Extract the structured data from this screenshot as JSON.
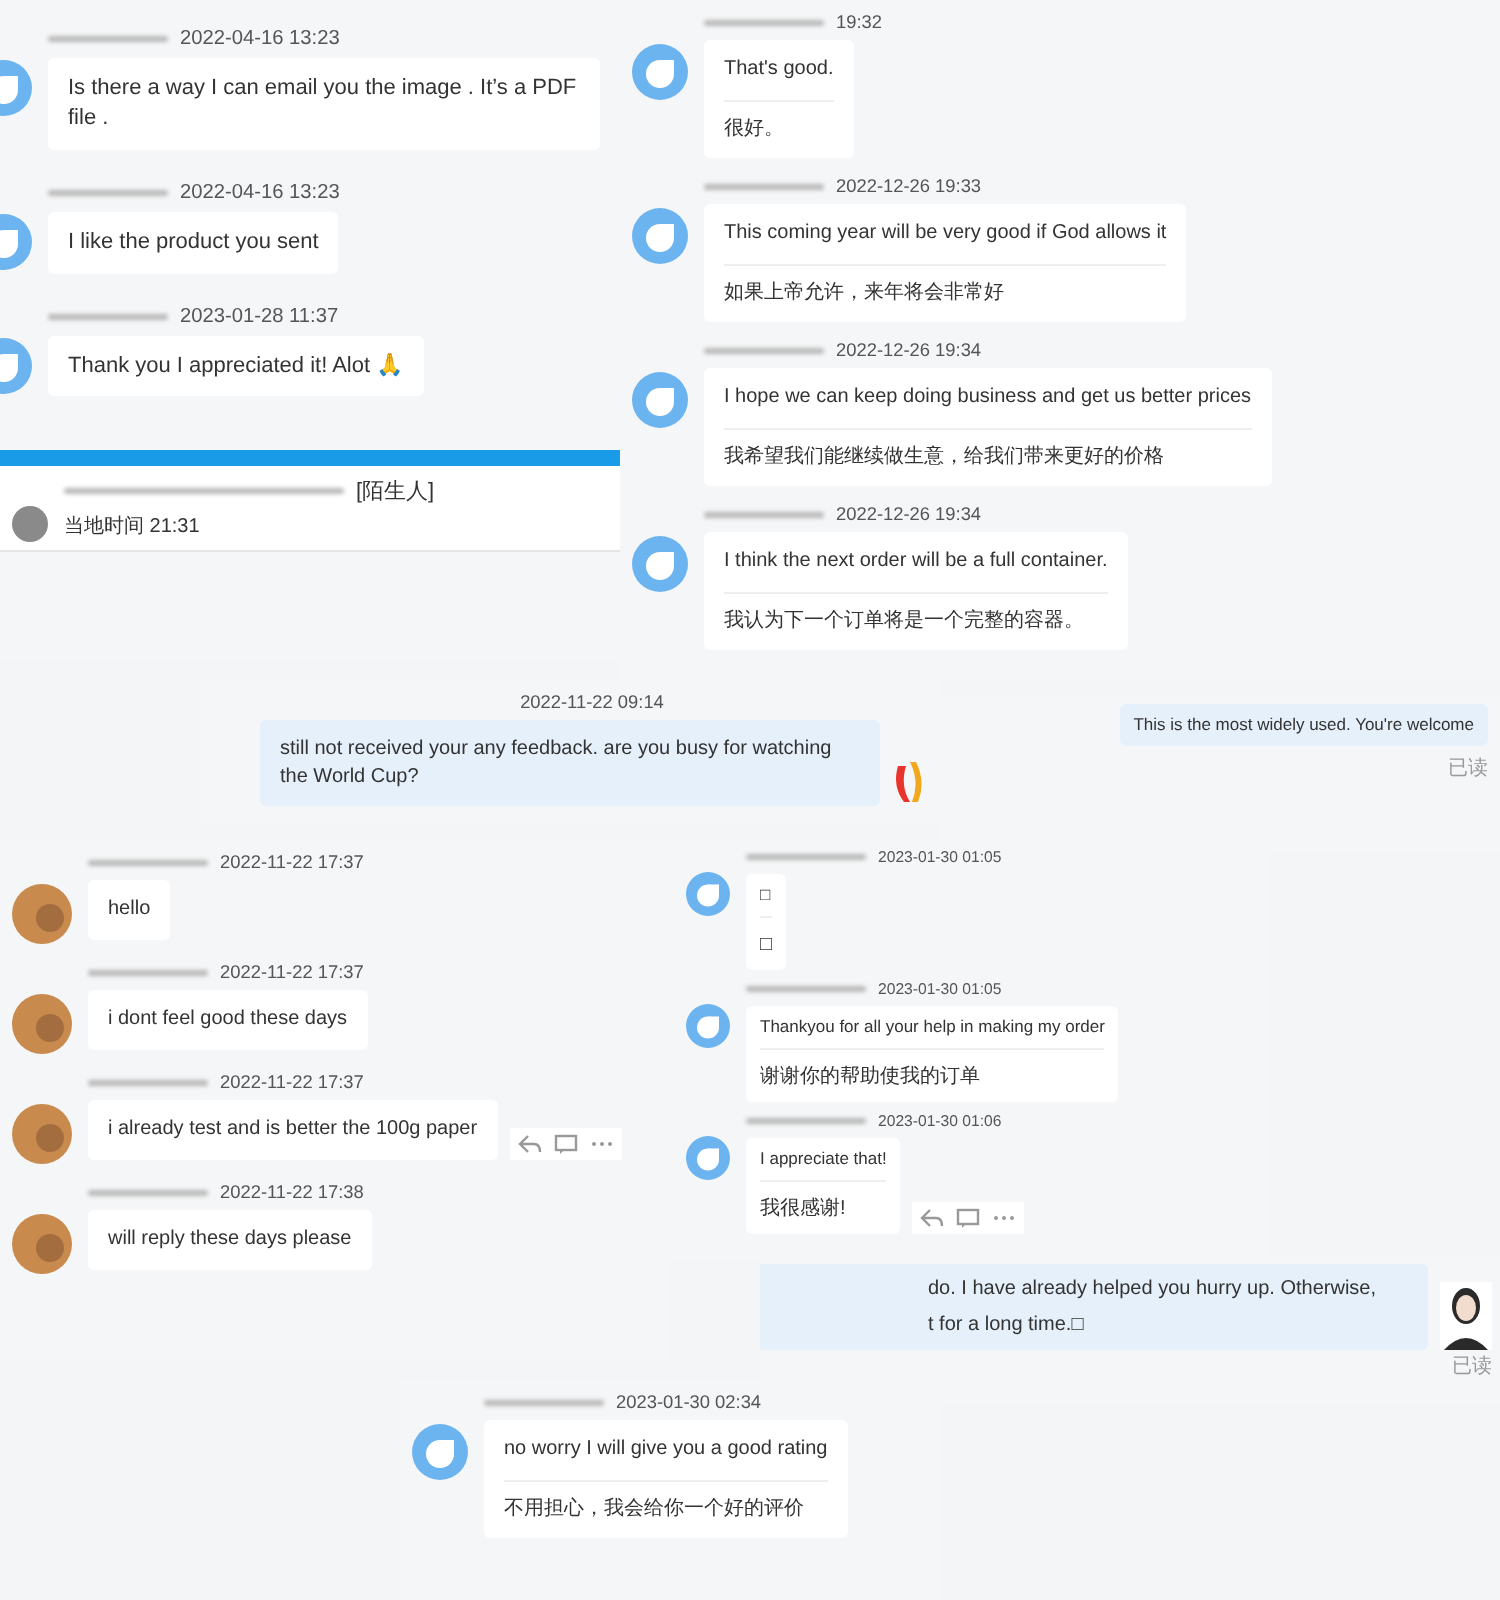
{
  "panels": [
    {
      "kind": "chat",
      "messages": [
        {
          "time": "2022-04-16 13:23",
          "kind": "blue",
          "outgoing": false,
          "lines": [
            "Is there a way I can email you the image . It’s a PDF file ."
          ]
        },
        {
          "time": "2022-04-16 13:23",
          "kind": "blue",
          "outgoing": false,
          "lines": [
            "I like the product you sent"
          ]
        },
        {
          "time": "2023-01-28 11:37",
          "kind": "blue",
          "outgoing": false,
          "lines": [
            "Thank you I appreciated it! Alot 🙏"
          ]
        }
      ]
    },
    {
      "kind": "contact",
      "tag": "[陌生人]",
      "local_time": "当地时间 21:31"
    },
    {
      "kind": "chat",
      "messages": [
        {
          "time": "19:32",
          "kind": "blue",
          "outgoing": false,
          "lines": [
            "That's good.",
            "很好。"
          ]
        },
        {
          "time": "2022-12-26 19:33",
          "kind": "blue",
          "outgoing": false,
          "lines": [
            "This coming year will be very good if God allows it",
            "如果上帝允许，来年将会非常好"
          ]
        },
        {
          "time": "2022-12-26 19:34",
          "kind": "blue",
          "outgoing": false,
          "lines": [
            "I hope we can keep doing business and get us better prices",
            "我希望我们能继续做生意，给我们带来更好的价格"
          ]
        },
        {
          "time": "2022-12-26 19:34",
          "kind": "blue",
          "outgoing": false,
          "lines": [
            "I think the next order will be a full container.",
            "我认为下一个订单将是一个完整的容器。"
          ]
        }
      ]
    },
    {
      "kind": "chat",
      "messages": [
        {
          "time": "2022-11-22 09:14",
          "kind": "logo",
          "outgoing": true,
          "lines": [
            "still not received your any feedback. are you busy for watching the World Cup?"
          ]
        }
      ]
    },
    {
      "kind": "chat",
      "messages": [
        {
          "kind": "plain",
          "outgoing": true,
          "lines": [
            "This is the most widely used. You're welcome"
          ],
          "read_label": "已读"
        }
      ]
    },
    {
      "kind": "chat",
      "messages": [
        {
          "time": "2022-11-22 17:37",
          "kind": "brown",
          "outgoing": false,
          "lines": [
            "hello"
          ]
        },
        {
          "time": "2022-11-22 17:37",
          "kind": "brown",
          "outgoing": false,
          "lines": [
            "i dont feel good these days"
          ]
        },
        {
          "time": "2022-11-22 17:37",
          "kind": "brown",
          "outgoing": false,
          "lines": [
            "i already test and is better the 100g paper"
          ],
          "actions": true
        },
        {
          "time": "2022-11-22 17:38",
          "kind": "brown",
          "outgoing": false,
          "lines": [
            "will reply these days please"
          ]
        }
      ]
    },
    {
      "kind": "chat",
      "messages": [
        {
          "time": "2023-01-30 01:05",
          "kind": "blue",
          "outgoing": false,
          "lines": [
            "□",
            "□"
          ]
        },
        {
          "time": "2023-01-30 01:05",
          "kind": "blue",
          "outgoing": false,
          "lines": [
            "Thankyou for all your help in making my order",
            "谢谢你的帮助使我的订单"
          ]
        },
        {
          "time": "2023-01-30 01:06",
          "kind": "blue",
          "outgoing": false,
          "lines": [
            "I appreciate that!",
            "我很感谢!"
          ],
          "actions": true
        }
      ]
    },
    {
      "kind": "chat",
      "messages": [
        {
          "kind": "person",
          "outgoing": true,
          "lines": [
            "do. I have already helped you hurry up. Otherwise,",
            "t for a long time.□"
          ],
          "read_label": "已读"
        }
      ]
    },
    {
      "kind": "chat",
      "messages": [
        {
          "time": "2023-01-30 02:34",
          "kind": "blue",
          "outgoing": false,
          "lines": [
            "no worry I will give you a good rating",
            "不用担心，我会给你一个好的评价"
          ]
        }
      ]
    }
  ]
}
